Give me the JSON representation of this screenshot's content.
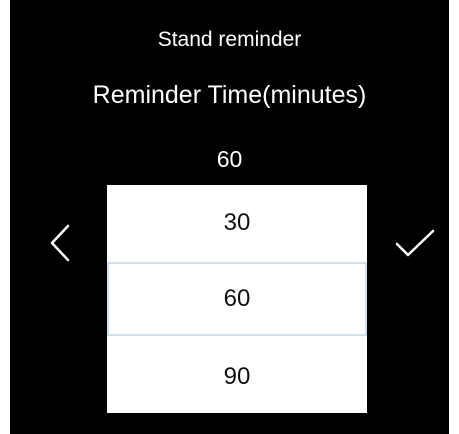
{
  "header": {
    "title": "Stand reminder",
    "subtitle": "Reminder Time(minutes)"
  },
  "picker": {
    "current_value": "60",
    "options": [
      "30",
      "60",
      "90"
    ],
    "selected": "60"
  },
  "icons": {
    "back": "chevron-left-icon",
    "confirm": "check-icon"
  },
  "colors": {
    "background": "#000000",
    "text": "#ffffff",
    "picker_background": "#ffffff",
    "picker_text": "#111111",
    "selection_border": "#cfe3ef"
  }
}
